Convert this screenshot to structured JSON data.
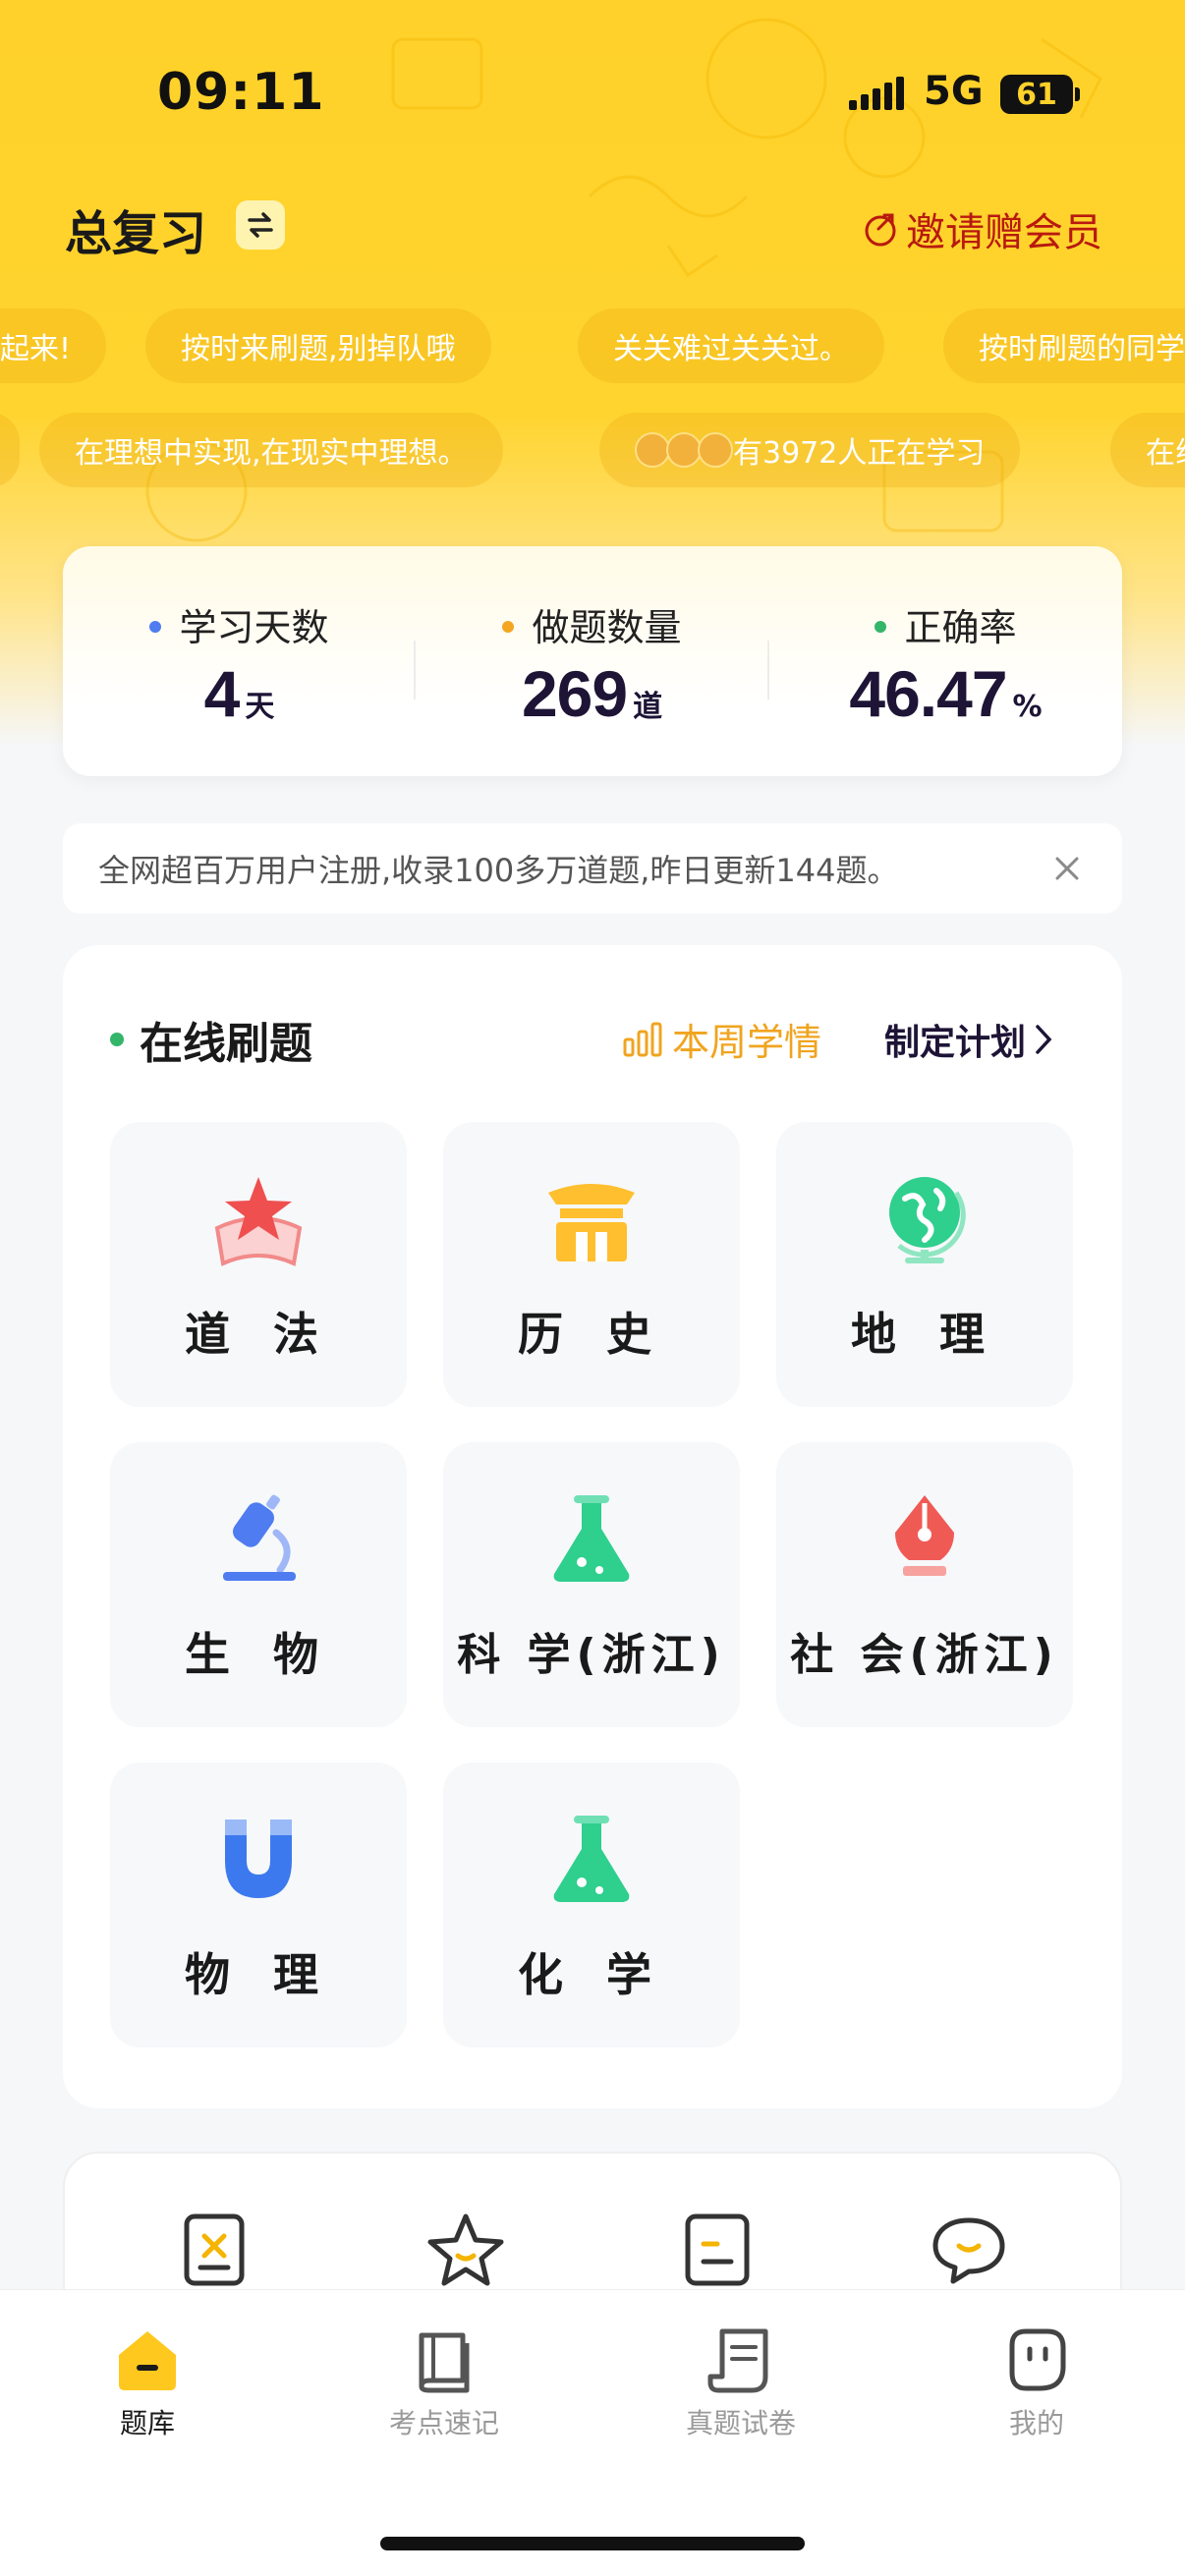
{
  "status_bar": {
    "time": "09:11",
    "network": "5G",
    "battery": "61"
  },
  "header": {
    "title": "总复习",
    "invite_label": "邀请赠会员"
  },
  "marquee": {
    "row1": [
      "起来!",
      "按时来刷题,别掉队哦",
      "关关难过关关过。",
      "按时刷题的同学"
    ],
    "row2": [
      "在理想中实现,在现实中理想。",
      "有3972人正在学习",
      "在线"
    ]
  },
  "stats": [
    {
      "label": "学习天数",
      "value": "4",
      "unit": "天",
      "dot_color": "#4f7cf0"
    },
    {
      "label": "做题数量",
      "value": "269",
      "unit": "道",
      "dot_color": "#f4a623"
    },
    {
      "label": "正确率",
      "value": "46.47",
      "unit": "%",
      "dot_color": "#33b56a"
    }
  ],
  "notice": {
    "text": "全网超百万用户注册,收录100多万道题,昨日更新144题。"
  },
  "practice": {
    "title": "在线刷题",
    "week_stats_label": "本周学情",
    "plan_label": "制定计划",
    "subjects": [
      {
        "label": "道 法",
        "icon": "star-banner-icon"
      },
      {
        "label": "历 史",
        "icon": "pavilion-icon"
      },
      {
        "label": "地 理",
        "icon": "globe-icon"
      },
      {
        "label": "生 物",
        "icon": "microscope-icon"
      },
      {
        "label": "科 学(浙江)",
        "icon": "flask-icon"
      },
      {
        "label": "社 会(浙江)",
        "icon": "pen-nib-icon"
      },
      {
        "label": "物 理",
        "icon": "magnet-icon"
      },
      {
        "label": "化 学",
        "icon": "flask-icon"
      }
    ]
  },
  "tabbar": {
    "items": [
      {
        "label": "题库",
        "icon": "house-icon",
        "active": true
      },
      {
        "label": "考点速记",
        "icon": "book-icon",
        "active": false
      },
      {
        "label": "真题试卷",
        "icon": "scroll-icon",
        "active": false
      },
      {
        "label": "我的",
        "icon": "face-icon",
        "active": false
      }
    ]
  },
  "colors": {
    "brand_yellow": "#ffd12a",
    "invite_red": "#b8190f",
    "accent_orange": "#f0a41f",
    "green": "#33b56a"
  }
}
